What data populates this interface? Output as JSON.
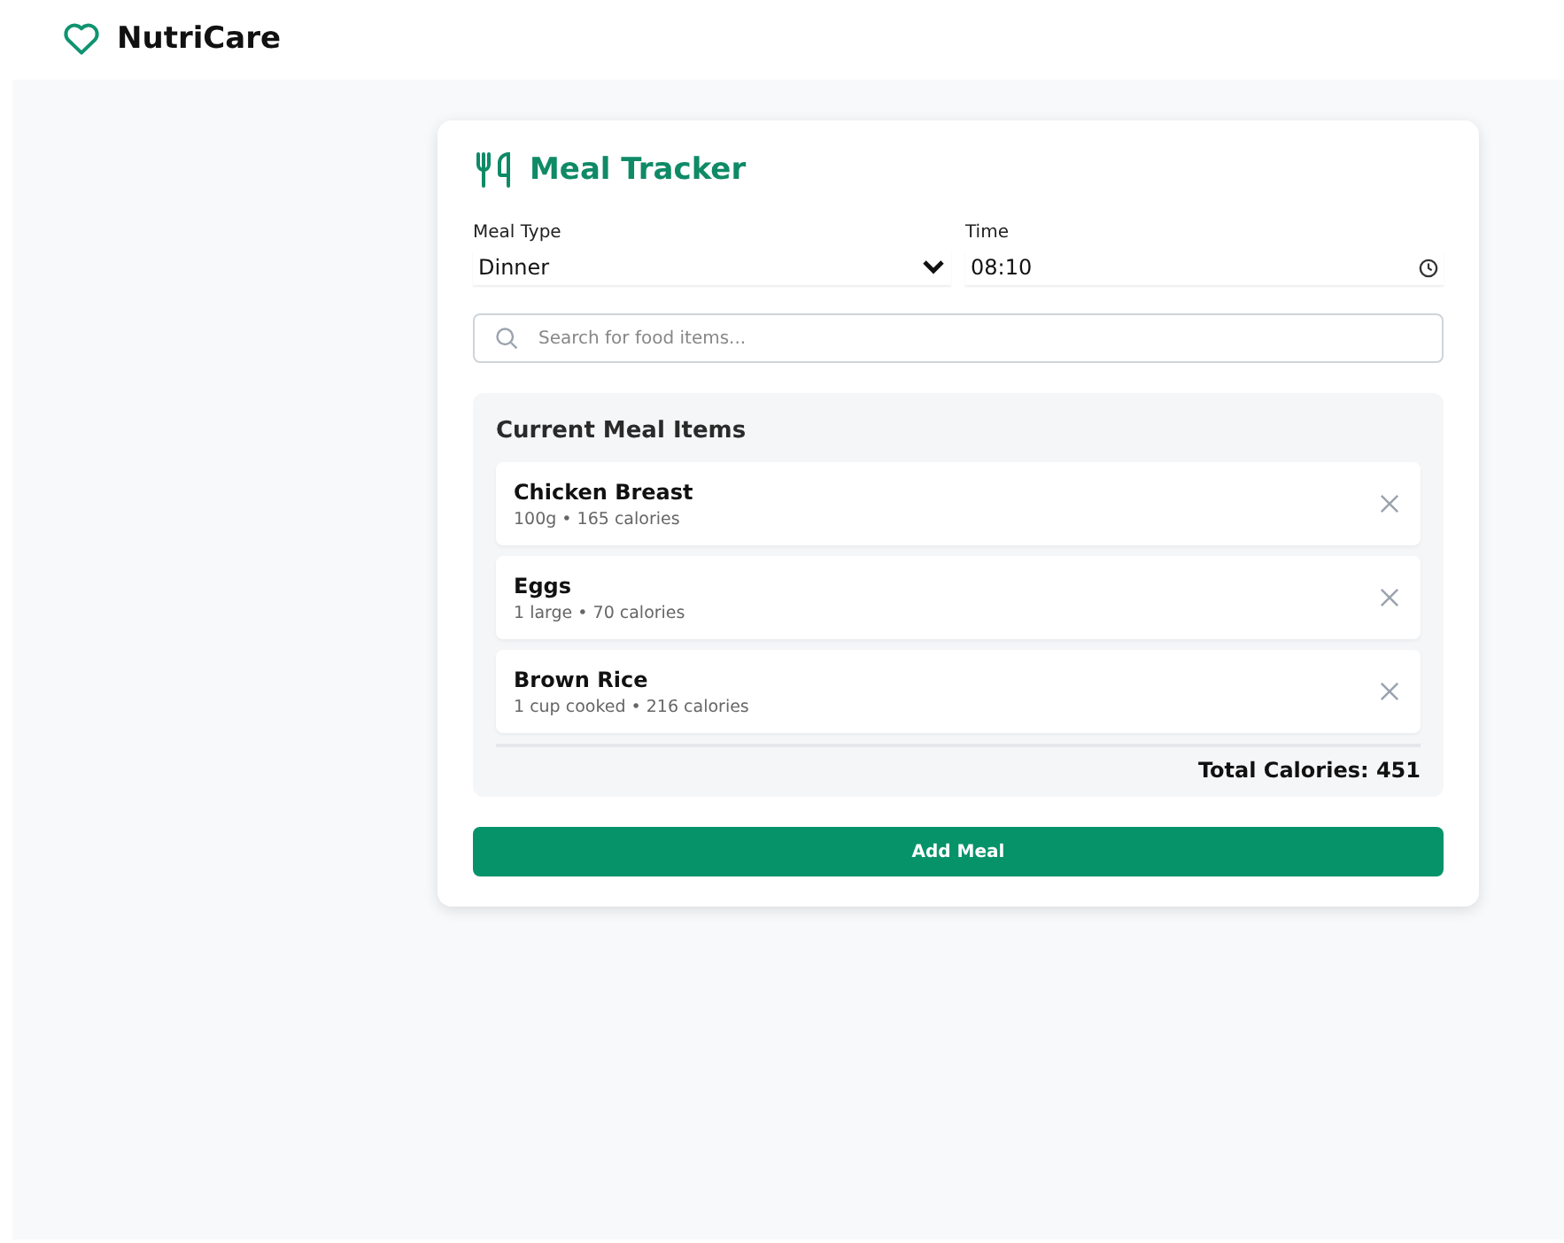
{
  "header": {
    "brand": "NutriCare"
  },
  "tracker": {
    "title": "Meal Tracker",
    "meal_type": {
      "label": "Meal Type",
      "value": "Dinner"
    },
    "time": {
      "label": "Time",
      "value": "08:10"
    },
    "search": {
      "placeholder": "Search for food items..."
    },
    "current_items": {
      "title": "Current Meal Items",
      "items": [
        {
          "name": "Chicken Breast",
          "detail": "100g • 165 calories"
        },
        {
          "name": "Eggs",
          "detail": "1 large • 70 calories"
        },
        {
          "name": "Brown Rice",
          "detail": "1 cup cooked • 216 calories"
        }
      ],
      "total": "Total Calories: 451"
    },
    "button": "Add Meal"
  }
}
